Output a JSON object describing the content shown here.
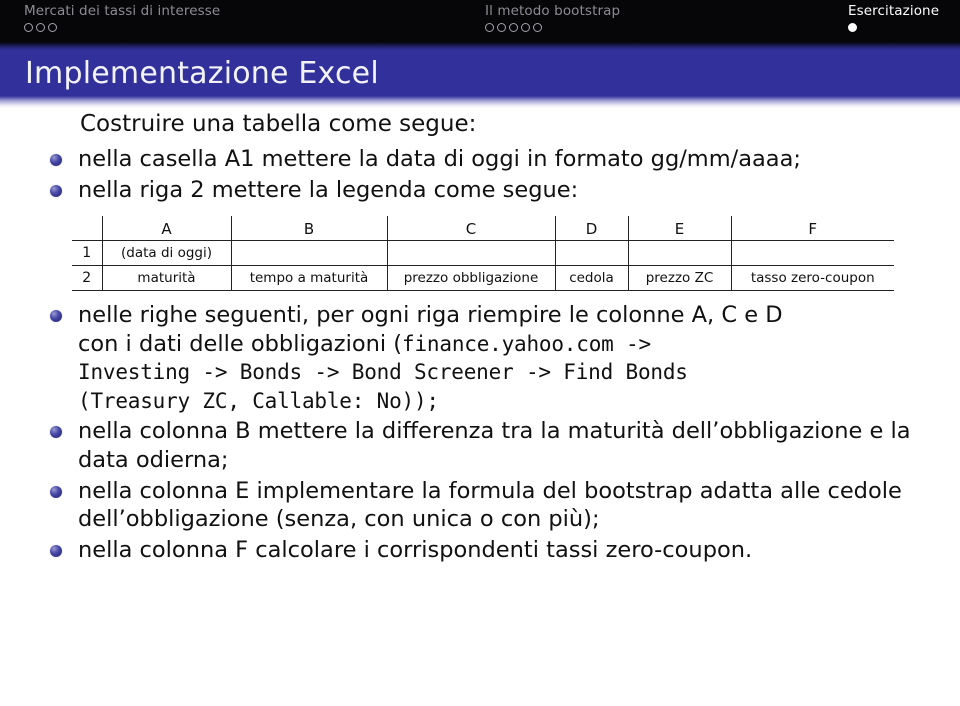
{
  "navbar": {
    "sections": [
      {
        "title": "Mercati dei tassi di interesse",
        "dots": [
          "empty",
          "empty",
          "empty"
        ],
        "active": false
      },
      {
        "title": "Il metodo bootstrap",
        "dots": [
          "empty",
          "empty",
          "empty",
          "empty",
          "empty"
        ],
        "active": false
      },
      {
        "title": "Esercitazione",
        "dots": [
          "filled"
        ],
        "active": true
      }
    ]
  },
  "slide": {
    "frame_title": "Implementazione Excel",
    "intro": "Costruire una tabella come segue:",
    "bullets_top": [
      "nella casella A1 mettere la data di oggi in formato gg/mm/aaaa;",
      "nella riga 2 mettere la legenda come segue:"
    ],
    "table": {
      "column_letters": [
        "A",
        "B",
        "C",
        "D",
        "E",
        "F"
      ],
      "rows": [
        {
          "number": "1",
          "cells": [
            "(data di oggi)",
            "",
            "",
            "",
            "",
            ""
          ]
        },
        {
          "number": "2",
          "cells": [
            "maturità",
            "tempo a maturità",
            "prezzo obbligazione",
            "cedola",
            "prezzo ZC",
            "tasso zero-coupon"
          ]
        }
      ]
    },
    "bullet_data": {
      "line1": "nelle righe seguenti, per ogni riga riempire le colonne A, C e D",
      "line2_prefix": "con i dati delle obbligazioni (",
      "line2_mono": "finance.yahoo.com ->",
      "line3_mono": "Investing -> Bonds -> Bond Screener -> Find Bonds",
      "line4_mono": "(Treasury ZC, Callable:  No));"
    },
    "bullets_bottom": [
      "nella colonna B mettere la differenza tra la maturità dell’obbligazione e la data odierna;",
      "nella colonna E implementare la formula del bootstrap adatta alle cedole dell’obbligazione (senza, con unica o con più);",
      "nella colonna F calcolare i corrispondenti tassi zero-coupon."
    ]
  },
  "colors": {
    "navbar_bg": "#060608",
    "title_band": "#32319c",
    "bullet": "#3b3b9e",
    "text": "#111111",
    "nav_dim": "#8c8c93"
  }
}
